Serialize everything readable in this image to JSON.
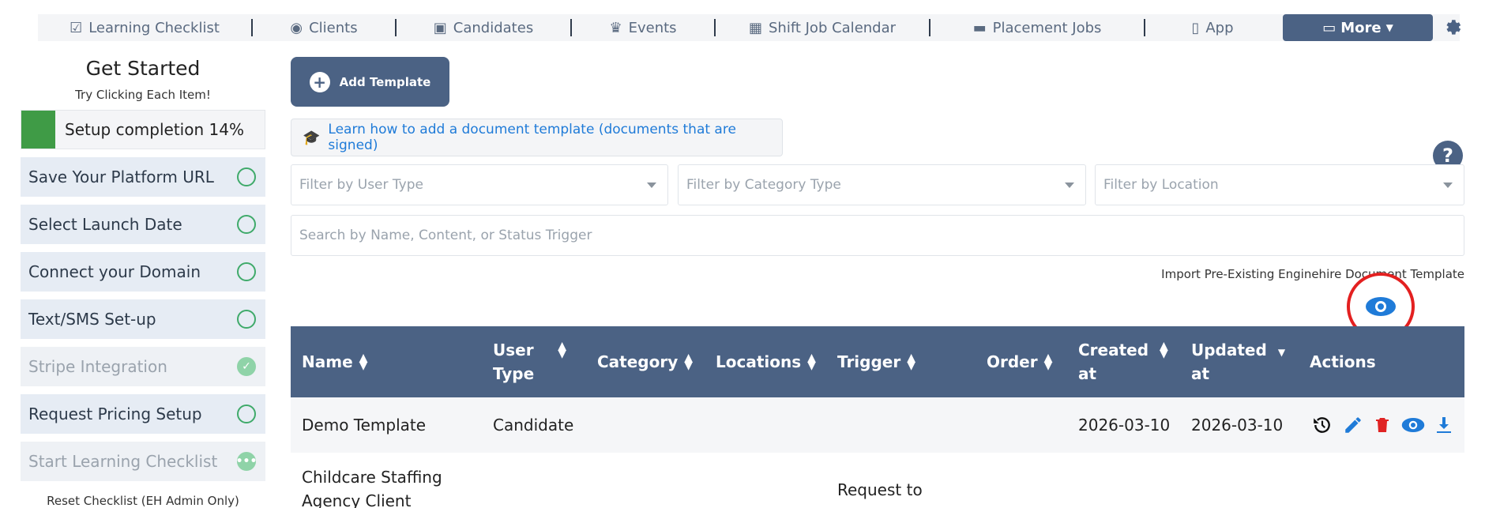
{
  "nav": {
    "items": [
      {
        "label": "Learning Checklist",
        "icon": "checklist-icon"
      },
      {
        "label": "Clients",
        "icon": "palette-icon"
      },
      {
        "label": "Candidates",
        "icon": "id-badge-icon"
      },
      {
        "label": "Events",
        "icon": "trophy-icon"
      },
      {
        "label": "Shift Job Calendar",
        "icon": "calendar-icon"
      },
      {
        "label": "Placement Jobs",
        "icon": "briefcase-icon"
      },
      {
        "label": "App",
        "icon": "mobile-icon"
      }
    ],
    "more_label": "More",
    "colors": {
      "bar": "#f4f5f7",
      "text": "#5a6a80",
      "accent": "#4b6284"
    }
  },
  "sidebar": {
    "title": "Get Started",
    "subtitle": "Try Clicking Each Item!",
    "progress_label": "Setup completion 14%",
    "progress_value": 0.14,
    "items": [
      {
        "label": "Save Your Platform URL",
        "state": "todo"
      },
      {
        "label": "Select Launch Date",
        "state": "todo"
      },
      {
        "label": "Connect your Domain",
        "state": "todo"
      },
      {
        "label": "Text/SMS Set-up",
        "state": "todo"
      },
      {
        "label": "Stripe Integration",
        "state": "done"
      },
      {
        "label": "Request Pricing Setup",
        "state": "todo"
      },
      {
        "label": "Start Learning Checklist",
        "state": "in-progress"
      }
    ],
    "reset_label": "Reset Checklist (EH Admin Only)"
  },
  "main": {
    "add_template_label": "Add Template",
    "learn_link": "Learn how to add a document template (documents that are signed)",
    "filters": {
      "user_type_placeholder": "Filter by User Type",
      "category_placeholder": "Filter by Category Type",
      "location_placeholder": "Filter by Location"
    },
    "search_placeholder": "Search by Name, Content, or Status Trigger",
    "import_label": "Import Pre-Existing Enginehire Document Template",
    "help_label": "?"
  },
  "table": {
    "headers": {
      "name": "Name",
      "user_type_1": "User",
      "user_type_2": "Type",
      "category": "Category",
      "locations": "Locations",
      "trigger": "Trigger",
      "order": "Order",
      "created_1": "Created",
      "created_2": "at",
      "updated_1": "Updated",
      "updated_2": "at",
      "actions": "Actions"
    },
    "rows": [
      {
        "name": "Demo Template",
        "user_type": "Candidate",
        "category": "",
        "locations": "",
        "trigger": "",
        "order": "",
        "created": "2026-03-10",
        "updated": "2026-03-10"
      },
      {
        "name_1": "Childcare Staffing",
        "name_2": "Agency Client",
        "trigger_1": "Request to"
      }
    ]
  },
  "colors": {
    "header_bg": "#4b6284",
    "progress_green": "#3f9b46",
    "checklist_bg": "#e6ecf4",
    "link_blue": "#1f7bd8",
    "delete_red": "#e02424",
    "callout_red": "#e32020"
  }
}
